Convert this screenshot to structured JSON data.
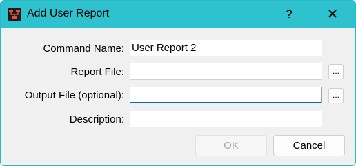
{
  "window": {
    "title": "Add User Report",
    "help_glyph": "?",
    "close_glyph": "✕",
    "app_icon": "report-app-icon"
  },
  "form": {
    "command_name": {
      "label": "Command Name:",
      "value": "User Report 2"
    },
    "report_file": {
      "label": "Report File:",
      "value": "",
      "browse_label": "..."
    },
    "output_file": {
      "label": "Output File (optional):",
      "value": "",
      "browse_label": "..."
    },
    "description": {
      "label": "Description:",
      "value": ""
    }
  },
  "buttons": {
    "ok_label": "OK",
    "ok_enabled": false,
    "cancel_label": "Cancel"
  },
  "colors": {
    "titlebar": "#2ec2ce",
    "dialog_background": "#f0f0f0",
    "focus_accent": "#0a64c2",
    "disabled_text": "#a6a6a6"
  }
}
